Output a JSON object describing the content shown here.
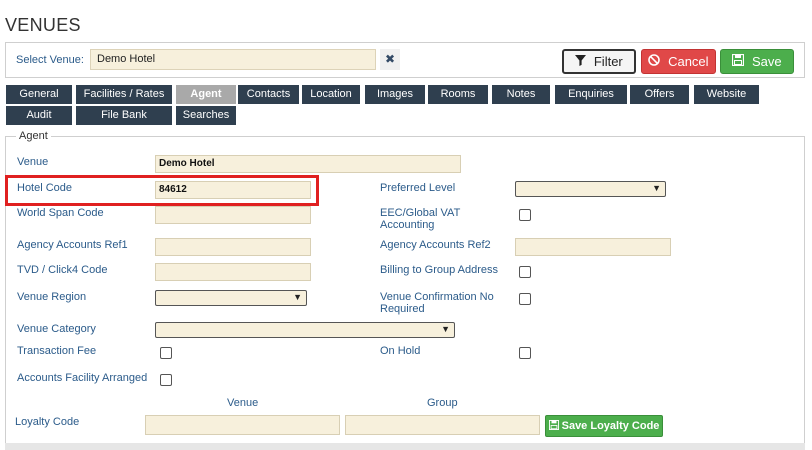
{
  "page": {
    "title": "VENUES"
  },
  "select_bar": {
    "label": "Select Venue:",
    "value": "Demo Hotel",
    "clear_icon": "✖"
  },
  "buttons": {
    "filter": "Filter",
    "cancel": "Cancel",
    "save": "Save",
    "filter_icon": "filter-icon",
    "cancel_icon": "ban-icon",
    "save_icon": "floppy-icon"
  },
  "tabs_row1": [
    "General",
    "Facilities / Rates",
    "Agent",
    "Contacts",
    "Location",
    "Images",
    "Rooms",
    "Notes",
    "Enquiries",
    "Offers",
    "Website"
  ],
  "tabs_row2": [
    "Audit",
    "File Bank",
    "Searches"
  ],
  "active_tab": "Agent",
  "agent": {
    "legend": "Agent",
    "venue_label": "Venue",
    "venue_value": "Demo Hotel",
    "hotel_code_label": "Hotel Code",
    "hotel_code_value": "84612",
    "preferred_level_label": "Preferred Level",
    "world_span_label": "World Span Code",
    "eec_vat_label": "EEC/Global VAT Accounting",
    "agency_ref1_label": "Agency Accounts Ref1",
    "agency_ref2_label": "Agency Accounts Ref2",
    "tvd_label": "TVD / Click4 Code",
    "billing_group_label": "Billing to Group Address",
    "venue_region_label": "Venue Region",
    "venue_confirm_label": "Venue Confirmation No Required",
    "venue_category_label": "Venue Category",
    "transaction_fee_label": "Transaction Fee",
    "on_hold_label": "On Hold",
    "accounts_facility_label": "Accounts Facility Arranged"
  },
  "loyalty": {
    "label": "Loyalty Code",
    "venue_col": "Venue",
    "group_col": "Group",
    "save_button": "Save Loyalty Code"
  },
  "colors": {
    "tab_bg": "#2f3f4f",
    "tab_active_bg": "#a9a9a9",
    "input_bg": "#f7f0dc",
    "label_color": "#2b5b8a",
    "cancel_red": "#e04848",
    "save_green": "#4cae4c",
    "highlight_red": "#e02020"
  }
}
